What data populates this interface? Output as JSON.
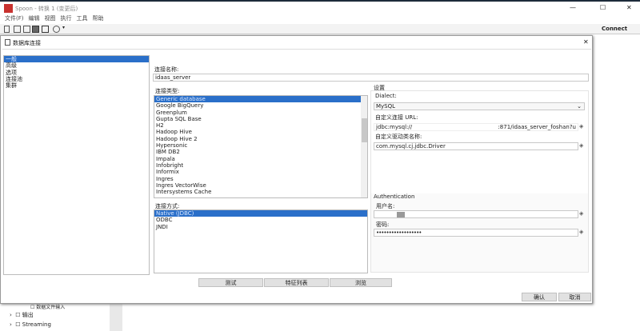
{
  "window": {
    "title": "Spoon - 转换 1 (变更后)",
    "connect": "Connect",
    "minimize": "—",
    "maximize": "☐",
    "close": "✕"
  },
  "menu": [
    "文件(F)",
    "编辑",
    "视图",
    "执行",
    "工具",
    "帮助"
  ],
  "dialog": {
    "title": "数据库连接",
    "close": "✕",
    "categories": [
      "一般",
      "高级",
      "选项",
      "连接池",
      "集群"
    ],
    "conn_name_label": "连接名称:",
    "conn_name": "idaas_server",
    "conn_type_label": "连接类型:",
    "conn_types": [
      "Generic database",
      "Google BigQuery",
      "Greenplum",
      "Gupta SQL Base",
      "H2",
      "Hadoop Hive",
      "Hadoop Hive 2",
      "Hypersonic",
      "IBM DB2",
      "Impala",
      "Infobright",
      "Informix",
      "Ingres",
      "Ingres VectorWise",
      "Intersystems Cache"
    ],
    "access_label": "连接方式:",
    "access_types": [
      "Native (JDBC)",
      "ODBC",
      "JNDI"
    ],
    "settings_label": "设置",
    "dialect_label": "Dialect:",
    "dialect": "MySQL",
    "url_label": "自定义连接 URL:",
    "url_start": "jdbc:mysql://",
    "url_end": ":871/idaas_server_foshan?u",
    "driver_label": "自定义驱动类名称:",
    "driver": "com.mysql.cj.jdbc.Driver",
    "auth_label": "Authentication",
    "user_label": "用户名:",
    "password_label": "密码:",
    "password": "••••••••••••••••••",
    "test": "测试",
    "features": "特征列表",
    "explore": "浏览",
    "ok": "确认",
    "cancel": "取消"
  },
  "tree": [
    "数据文件输入",
    "输出",
    "Streaming"
  ]
}
